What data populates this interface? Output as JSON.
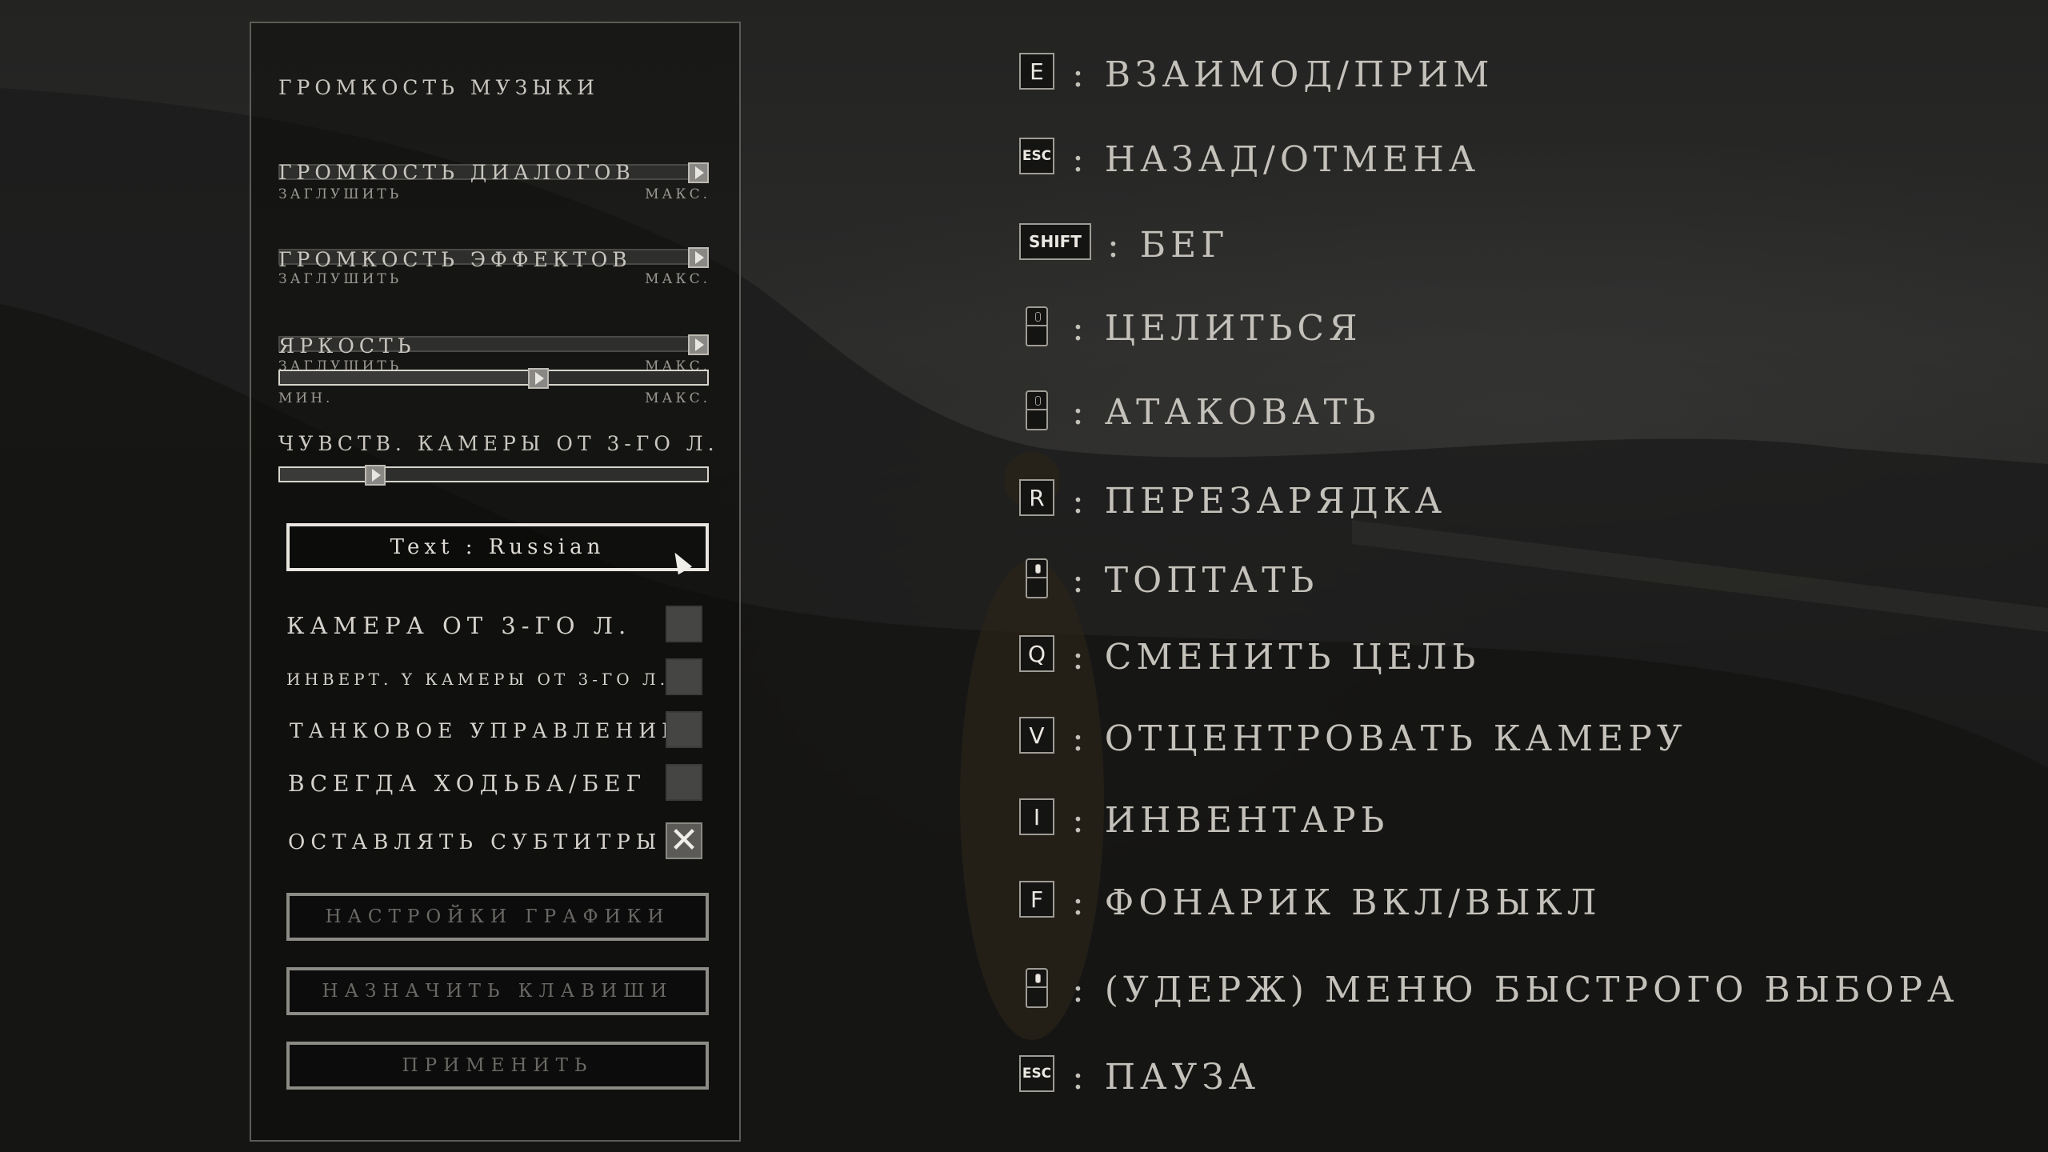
{
  "settings": {
    "sliders": [
      {
        "label": "ГРОМКОСТЬ МУЗЫКИ",
        "min_label": "ЗАГЛУШИТЬ",
        "max_label": "МАКС.",
        "value_percent": 100
      },
      {
        "label": "ГРОМКОСТЬ ДИАЛОГОВ",
        "min_label": "ЗАГЛУШИТЬ",
        "max_label": "МАКС.",
        "value_percent": 100
      },
      {
        "label": "ГРОМКОСТЬ ЭФФЕКТОВ",
        "min_label": "ЗАГЛУШИТЬ",
        "max_label": "МАКС.",
        "value_percent": 100
      },
      {
        "label": "ЯРКОСТЬ",
        "min_label": "МИН.",
        "max_label": "МАКС.",
        "value_percent": 60
      },
      {
        "label": "ЧУВСТВ. КАМЕРЫ ОТ 3-ГО Л.",
        "min_label": "",
        "max_label": "",
        "value_percent": 22
      }
    ],
    "language_button": "Text : Russian",
    "toggles": [
      {
        "label": "КАМЕРА ОТ 3-ГО Л.",
        "checked": false
      },
      {
        "label": "ИНВЕРТ. Y КАМЕРЫ ОТ 3-ГО Л.",
        "checked": false
      },
      {
        "label": "ТАНКОВОЕ УПРАВЛЕНИЕ",
        "checked": false
      },
      {
        "label": "ВСЕГДА ХОДЬБА/БЕГ",
        "checked": false
      },
      {
        "label": "ОСТАВЛЯТЬ СУБТИТРЫ",
        "checked": true
      }
    ],
    "buttons": {
      "graphics": "НАСТРОЙКИ ГРАФИКИ",
      "keybinds": "НАЗНАЧИТЬ КЛАВИШИ",
      "apply": "ПРИМЕНИТЬ"
    }
  },
  "controls": [
    {
      "key": "E",
      "key_type": "letter",
      "action": ": ВЗАИМОД/ПРИМ"
    },
    {
      "key": "ESC",
      "key_type": "small",
      "action": ": НАЗАД/ОТМЕНА"
    },
    {
      "key": "SHIFT",
      "key_type": "wide",
      "action": ": БЕГ"
    },
    {
      "key": "",
      "key_type": "mouse-left",
      "action": ": ЦЕЛИТЬСЯ"
    },
    {
      "key": "",
      "key_type": "mouse-right",
      "action": ": АТАКОВАТЬ"
    },
    {
      "key": "R",
      "key_type": "letter",
      "action": ": ПЕРЕЗАРЯДКА"
    },
    {
      "key": "",
      "key_type": "mouse-middle",
      "action": ": ТОПТАТЬ"
    },
    {
      "key": "Q",
      "key_type": "letter",
      "action": ": СМЕНИТЬ ЦЕЛЬ"
    },
    {
      "key": "V",
      "key_type": "letter",
      "action": ": ОТЦЕНТРОВАТЬ КАМЕРУ"
    },
    {
      "key": "I",
      "key_type": "letter",
      "action": ": ИНВЕНТАРЬ"
    },
    {
      "key": "F",
      "key_type": "letter",
      "action": ": ФОНАРИК ВКЛ/ВЫКЛ"
    },
    {
      "key": "",
      "key_type": "mouse-middle",
      "action": ": (УДЕРЖ) МЕНЮ БЫСТРОГО ВЫБОРА"
    },
    {
      "key": "ESC",
      "key_type": "small",
      "action": ": ПАУЗА"
    }
  ]
}
